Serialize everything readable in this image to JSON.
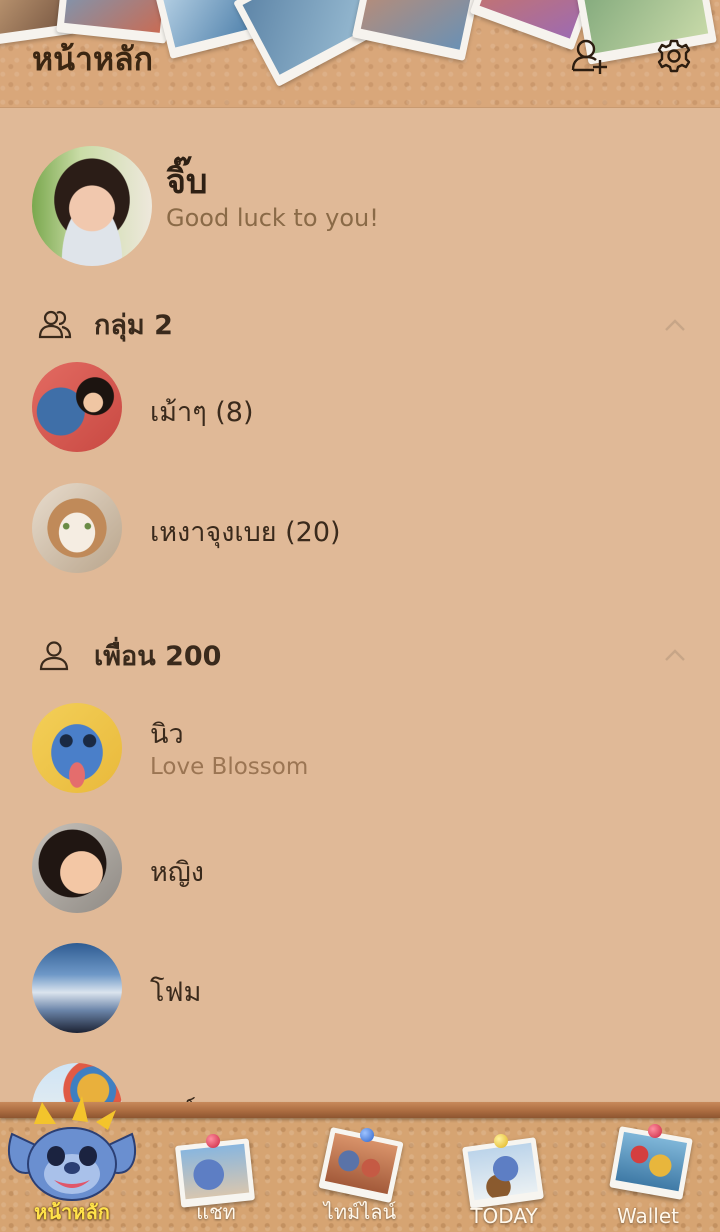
{
  "header": {
    "title": "หน้าหลัก",
    "add_friend_icon": "add-friend-icon",
    "settings_icon": "gear-icon"
  },
  "profile": {
    "name": "จิ๊บ",
    "status": "Good luck to you!"
  },
  "groups": {
    "label": "กลุ่ม 2",
    "items": [
      {
        "name": "เม้าๆ (8)"
      },
      {
        "name": "เหงาจุงเบย (20)"
      }
    ]
  },
  "friends": {
    "label": "เพื่อน 200",
    "items": [
      {
        "name": "นิว",
        "status": "Love Blossom"
      },
      {
        "name": "หญิง"
      },
      {
        "name": "โฟม"
      },
      {
        "name": "การ์ม"
      }
    ]
  },
  "tabs": [
    {
      "label": "หน้าหลัก",
      "active": true
    },
    {
      "label": "แชท"
    },
    {
      "label": "ไทม์ไลน์"
    },
    {
      "label": "TODAY"
    },
    {
      "label": "Wallet"
    }
  ],
  "colors": {
    "background": "#e0b997",
    "header": "#d9a77a",
    "active_tab": "#ffe24a",
    "status_text": "#8a6a47"
  }
}
